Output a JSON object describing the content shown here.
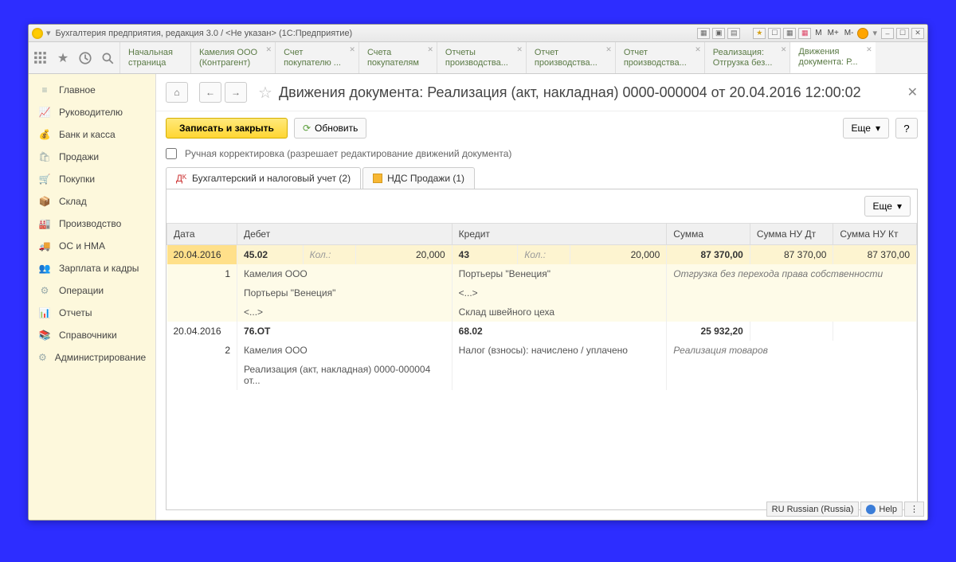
{
  "window_title": "Бухгалтерия предприятия, редакция 3.0 / <Не указан>  (1С:Предприятие)",
  "top_m": [
    "M",
    "M+",
    "M-"
  ],
  "tabs": [
    {
      "l1": "Начальная",
      "l2": "страница"
    },
    {
      "l1": "Камелия ООО",
      "l2": "(Контрагент)"
    },
    {
      "l1": "Счет",
      "l2": "покупателю ..."
    },
    {
      "l1": "Счета",
      "l2": "покупателям"
    },
    {
      "l1": "Отчеты",
      "l2": "производства..."
    },
    {
      "l1": "Отчет",
      "l2": "производства..."
    },
    {
      "l1": "Отчет",
      "l2": "производства..."
    },
    {
      "l1": "Реализация:",
      "l2": "Отгрузка без..."
    },
    {
      "l1": "Движения",
      "l2": "документа: Р..."
    }
  ],
  "sidebar": [
    "Главное",
    "Руководителю",
    "Банк и касса",
    "Продажи",
    "Покупки",
    "Склад",
    "Производство",
    "ОС и НМА",
    "Зарплата и кадры",
    "Операции",
    "Отчеты",
    "Справочники",
    "Администрирование"
  ],
  "doc_title": "Движения документа: Реализация (акт, накладная) 0000-000004 от 20.04.2016 12:00:02",
  "btn_save_close": "Записать и закрыть",
  "btn_refresh": "Обновить",
  "btn_more": "Еще",
  "checkbox_label": "Ручная корректировка (разрешает редактирование движений документа)",
  "subtabs": [
    "Бухгалтерский и налоговый учет (2)",
    "НДС Продажи (1)"
  ],
  "columns": [
    "Дата",
    "Дебет",
    "Кредит",
    "Сумма",
    "Сумма НУ Дт",
    "Сумма НУ Кт"
  ],
  "rows": [
    {
      "hl": true,
      "date": "20.04.2016",
      "seq": "1",
      "debit_acc": "45.02",
      "debit_qty_lbl": "Кол.:",
      "debit_qty": "20,000",
      "credit_acc": "43",
      "credit_qty_lbl": "Кол.:",
      "credit_qty": "20,000",
      "sum": "87 370,00",
      "sum_nu_dt": "87 370,00",
      "sum_nu_kt": "87 370,00",
      "sub1_d": "Камелия ООО",
      "sub1_c": "Портьеры \"Венеция\"",
      "note": "Отгрузка без перехода права собственности",
      "sub2_d": "Портьеры \"Венеция\"",
      "sub2_c": "<...>",
      "sub3_d": "<...>",
      "sub3_c": "Склад швейного цеха"
    },
    {
      "hl": false,
      "date": "20.04.2016",
      "seq": "2",
      "debit_acc": "76.ОТ",
      "credit_acc": "68.02",
      "sum": "25 932,20",
      "sub1_d": "Камелия ООО",
      "sub1_c": "Налог (взносы): начислено / уплачено",
      "note": "Реализация товаров",
      "sub2_d": "Реализация (акт, накладная) 0000-000004 от..."
    }
  ],
  "status_lang": "RU Russian (Russia)",
  "status_help": "Help"
}
